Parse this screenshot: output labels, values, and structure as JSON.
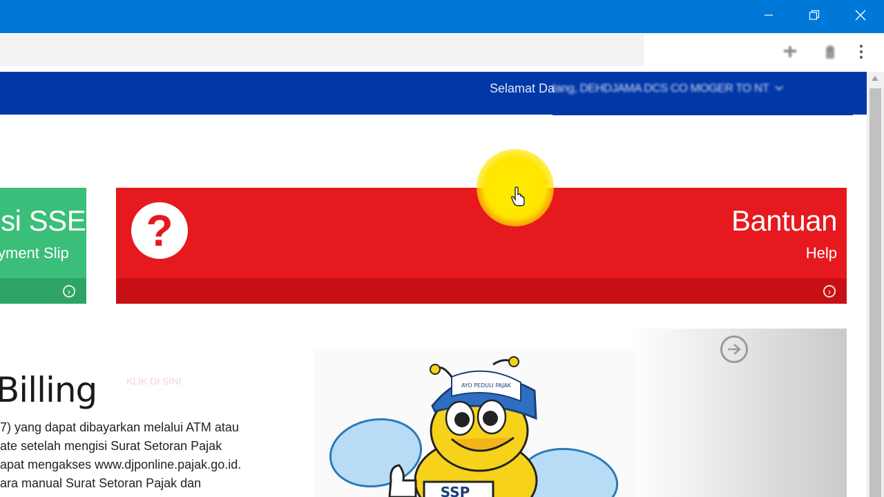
{
  "window": {
    "minimize_icon": "minimize-icon",
    "restore_icon": "restore-icon",
    "close_icon": "close-icon"
  },
  "toolbar": {
    "icons": [
      "pin-icon",
      "extension-icon",
      "menu-kebab-icon"
    ]
  },
  "header": {
    "welcome_label": "Selamat Da",
    "user_name_blurred": "tang, DEHDJAMA DCS CO MOGER TO  NT",
    "dropdown_icon": "chevron-down-icon"
  },
  "cards": {
    "green": {
      "title": "Isi SSE",
      "subtitle": "yment Slip",
      "arrow_icon": "arrow-right-circle-icon"
    },
    "red": {
      "icon": "question-mark-icon",
      "title": "Bantuan",
      "subtitle": "Help",
      "footer_label": "KLIK DI SINI",
      "arrow_icon": "arrow-right-circle-icon"
    }
  },
  "billing": {
    "title": "Billing",
    "lines": [
      "7) yang dapat dibayarkan melalui ATM atau",
      "ate setelah mengisi Surat Setoran Pajak",
      "apat mengakses www.djponline.pajak.go.id.",
      "ara manual Surat Setoran Pajak dan"
    ]
  },
  "mascot": {
    "cap_text": "AYO PEDULI PAJAK",
    "sign_text": "SSP"
  },
  "colors": {
    "titlebar": "#0078d7",
    "header": "#0038a8",
    "green_card": "#3bbe7a",
    "red_card": "#e6191e"
  }
}
